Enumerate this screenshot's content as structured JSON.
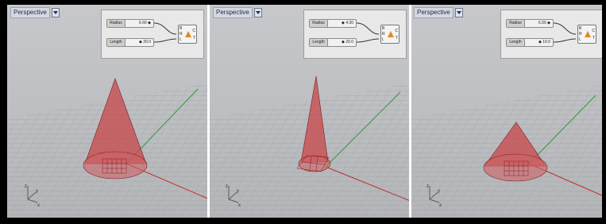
{
  "viewports": [
    {
      "title": "Perspective",
      "radius_label": "Radius",
      "radius_value": "6.60 ◆",
      "length_label": "Length",
      "length_value": "◆ 20.0",
      "ports_in": [
        "B",
        "R",
        "L"
      ],
      "ports_out": [
        "C",
        "T"
      ],
      "axes": [
        "z",
        "y",
        "x"
      ]
    },
    {
      "title": "Perspective",
      "radius_label": "Radius",
      "radius_value": "◆ 4.30",
      "length_label": "Length",
      "length_value": "◆ 20.0",
      "ports_in": [
        "B",
        "R",
        "L"
      ],
      "ports_out": [
        "C",
        "T"
      ],
      "axes": [
        "z",
        "y",
        "x"
      ]
    },
    {
      "title": "Perspective",
      "radius_label": "Radius",
      "radius_value": "6.50 ◆",
      "length_label": "Length",
      "length_value": "◆ 10.0",
      "ports_in": [
        "B",
        "R",
        "L"
      ],
      "ports_out": [
        "C",
        "T"
      ],
      "axes": [
        "z",
        "y",
        "x"
      ]
    }
  ],
  "colors": {
    "cone_fill": "#c8474a",
    "cone_stroke": "#7e1e22",
    "x_axis": "#c02a2a",
    "y_axis": "#2f9a3a",
    "grid": "#9ea1a5"
  }
}
